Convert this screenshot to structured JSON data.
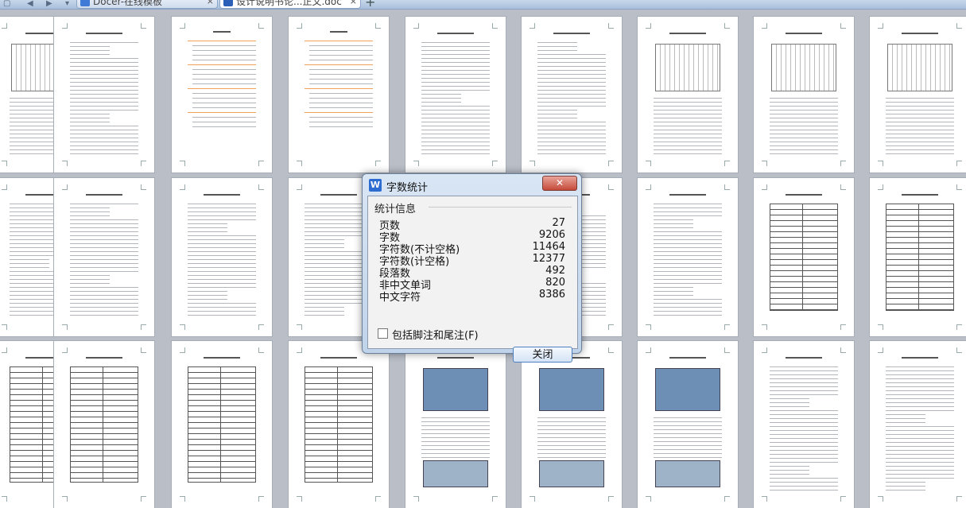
{
  "tabs": [
    {
      "label": "Docer-在线模板",
      "active": false
    },
    {
      "label": "设计说明书论...正文.doc",
      "active": true
    }
  ],
  "add_tab_label": "+",
  "dialog": {
    "title": "字数统计",
    "group_title": "统计信息",
    "stats": [
      {
        "label": "页数",
        "value": "27"
      },
      {
        "label": "字数",
        "value": "9206"
      },
      {
        "label": "字符数(不计空格)",
        "value": "11464"
      },
      {
        "label": "字符数(计空格)",
        "value": "12377"
      },
      {
        "label": "段落数",
        "value": "492"
      },
      {
        "label": "非中文单词",
        "value": "820"
      },
      {
        "label": "中文字符",
        "value": "8386"
      }
    ],
    "checkbox_label": "包括脚注和尾注(F)",
    "checkbox_checked": false,
    "close_button": "关闭",
    "title_close_glyph": "✕"
  }
}
